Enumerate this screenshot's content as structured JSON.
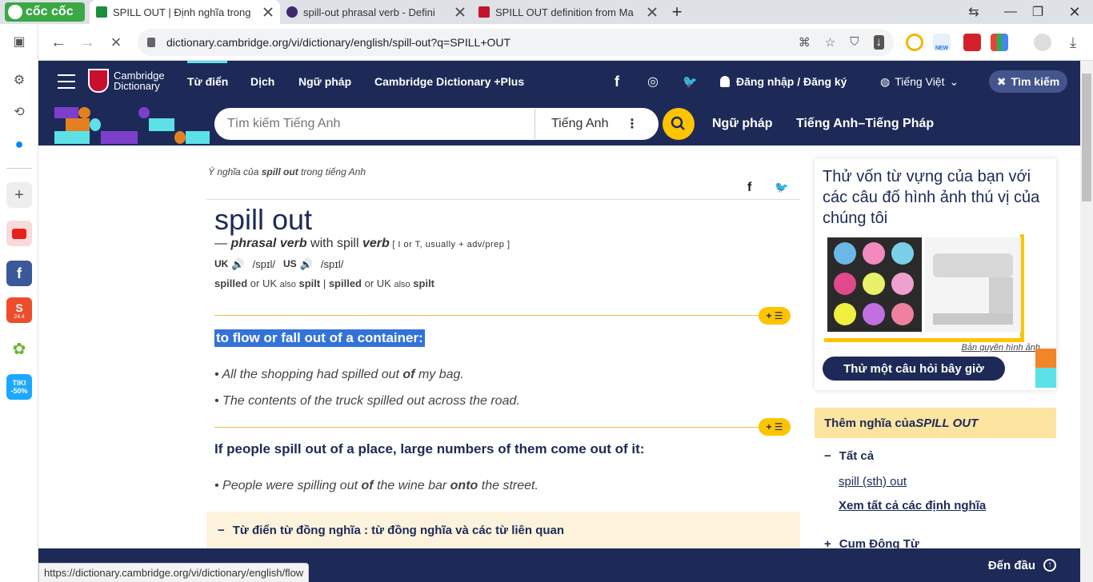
{
  "browser": {
    "brand": "cốc cốc",
    "tabs": [
      {
        "title": "SPILL OUT | Định nghĩa trong",
        "active": true
      },
      {
        "title": "spill-out phrasal verb - Defini",
        "active": false
      },
      {
        "title": "SPILL OUT definition from Ma",
        "active": false
      }
    ],
    "url": "dictionary.cambridge.org/vi/dictionary/english/spill-out?q=SPILL+OUT",
    "status_url": "https://dictionary.cambridge.org/vi/dictionary/english/flow",
    "ext_new_badge": "NEW",
    "rail_badges": {
      "shopee": "24.4",
      "tiki": "TIKI\n-50%"
    }
  },
  "site": {
    "logo_line1": "Cambridge",
    "logo_line2": "Dictionary",
    "nav": [
      "Từ điển",
      "Dịch",
      "Ngữ pháp",
      "Cambridge Dictionary +Plus"
    ],
    "login": "Đăng nhập / Đăng ký",
    "language": "Tiếng Việt",
    "search_button": "Tìm kiếm",
    "search_placeholder": "Tìm kiếm Tiếng Anh",
    "search_lang": "Tiếng Anh",
    "sub_nav": [
      "Ngữ pháp",
      "Tiếng Anh–Tiếng Pháp"
    ]
  },
  "entry": {
    "crumb_pre": "Ý nghĩa của ",
    "crumb_word": "spill out",
    "crumb_post": " trong tiếng Anh",
    "headword": "spill out",
    "pos_dash": "— ",
    "pos": "phrasal verb",
    "pos_with": " with spill ",
    "pos_verb": "verb",
    "grammar": " [ I or T, usually + adv/prep ]",
    "uk_label": "UK",
    "uk_ipa": "/spɪl/",
    "us_label": "US",
    "us_ipa": "/spɪl/",
    "forms": {
      "f1": "spilled",
      "or1": " or UK ",
      "also1": "also",
      "f2": "spilt",
      "sep": " | ",
      "f3": "spilled",
      "or2": " or UK ",
      "also2": "also",
      "f4": "spilt"
    },
    "plus_label": "+ ☰",
    "senses": [
      {
        "definition": "to flow or fall out of a container:",
        "examples": [
          {
            "pre": "All the shopping had spilled out ",
            "bold": "of",
            "post": " my bag.",
            "bold2": "",
            "post2": ""
          },
          {
            "pre": "The contents of the truck spilled out across the road.",
            "bold": "",
            "post": "",
            "bold2": "",
            "post2": ""
          }
        ]
      },
      {
        "definition": "If people spill out of a place, large numbers of them come out of it:",
        "examples": [
          {
            "pre": "People were spilling out ",
            "bold": "of",
            "post": " the wine bar ",
            "bold2": "onto",
            "post2": " the street."
          }
        ]
      }
    ],
    "thesaurus": "Từ điển từ đồng nghĩa : từ đồng nghĩa và các từ liên quan"
  },
  "sidebar": {
    "quiz_title": "Thử vốn từ vựng của bạn với các câu đố hình ảnh thú vị của chúng tôi",
    "credit": "Bản quyền hình ảnh",
    "quiz_button": "Thử một câu hỏi bây giờ",
    "more_pre": "Thêm nghĩa của ",
    "more_word": "SPILL OUT",
    "all": "Tất cả",
    "link1": "spill (sth) out",
    "link2": "Xem tất cả các định nghĩa",
    "phrasal": "Cụm Động Từ"
  },
  "footer": {
    "to_top": "Đến đầu"
  },
  "colors": {
    "navy": "#1d2a57",
    "yellow": "#fec400",
    "highlight": "#3373d9"
  }
}
